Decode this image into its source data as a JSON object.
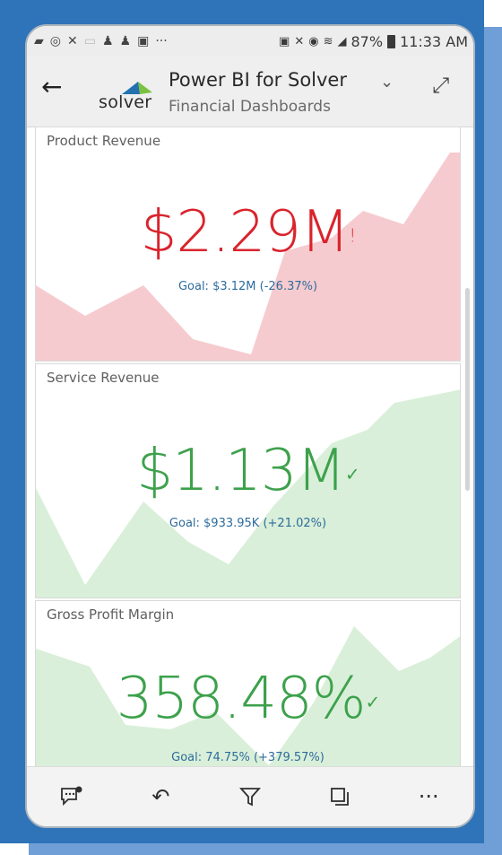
{
  "status_bar": {
    "left_icons": [
      "gallery-icon",
      "whatsapp-icon",
      "missed-call-icon",
      "image-icon",
      "person-icon",
      "person-icon",
      "photo-icon",
      "more-icon"
    ],
    "battery_percent": "87%",
    "time": "11:33 AM"
  },
  "header": {
    "logo_text": "solver",
    "title": "Power BI for Solver",
    "subtitle": "Financial Dashboards"
  },
  "tiles": [
    {
      "title": "Product Revenue",
      "value": "$2.29M",
      "indicator": "!",
      "goal": "Goal: $3.12M (-26.37%)",
      "color": "#d9242d",
      "fill": "#f6cbcf"
    },
    {
      "title": "Service Revenue",
      "value": "$1.13M",
      "indicator": "✓",
      "goal": "Goal: $933.95K (+21.02%)",
      "color": "#3da14c",
      "fill": "#d9efd9"
    },
    {
      "title": "Gross Profit Margin",
      "value": "358.48%",
      "indicator": "✓",
      "goal": "Goal: 74.75% (+379.57%)",
      "color": "#3da14c",
      "fill": "#d9efd9"
    }
  ],
  "bottom_bar": {
    "icons": [
      "comment-icon",
      "undo-icon",
      "filter-icon",
      "copy-icon",
      "more-icon"
    ]
  }
}
